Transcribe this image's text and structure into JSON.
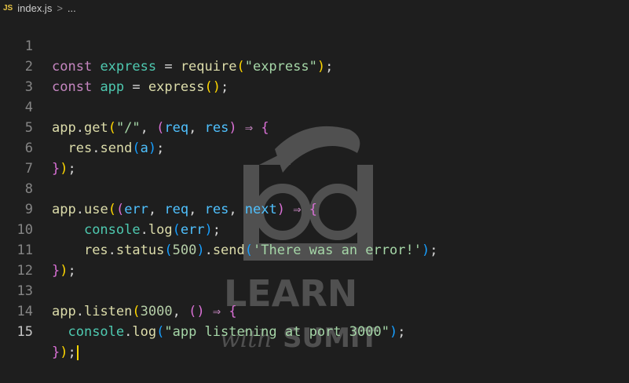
{
  "breadcrumb": {
    "file_badge": "JS",
    "file_name": "index.js",
    "separator": ">",
    "tail": "..."
  },
  "editor": {
    "active_line": 15,
    "line_numbers": [
      "1",
      "2",
      "3",
      "4",
      "5",
      "6",
      "7",
      "8",
      "9",
      "10",
      "11",
      "12",
      "13",
      "14",
      "15"
    ],
    "lines": [
      "const express = require(\"express\");",
      "const app = express();",
      "",
      "app.get(\"/\", (req, res) ⇒ {",
      "  res.send(a);",
      "});",
      "",
      "app.use((err, req, res, next) ⇒ {",
      "    console.log(err);",
      "    res.status(500).send('There was an error!');",
      "});",
      "",
      "app.listen(3000, () ⇒ {",
      "  console.log(\"app listening at port 3000\");",
      "});"
    ]
  },
  "watermark": {
    "line1": "LEARN",
    "line2": "with",
    "line3": "SUMIT"
  },
  "colors": {
    "background": "#1e1e1e",
    "keyword": "#c586c0",
    "variable": "#4ec9b0",
    "function": "#dcdcaa",
    "string": "#ce9178",
    "number": "#b5cea8",
    "cursor": "#ffd700"
  },
  "icons": {
    "file_type": "javascript-file-icon",
    "watermark_logo": "learn-with-sumit-logo"
  }
}
